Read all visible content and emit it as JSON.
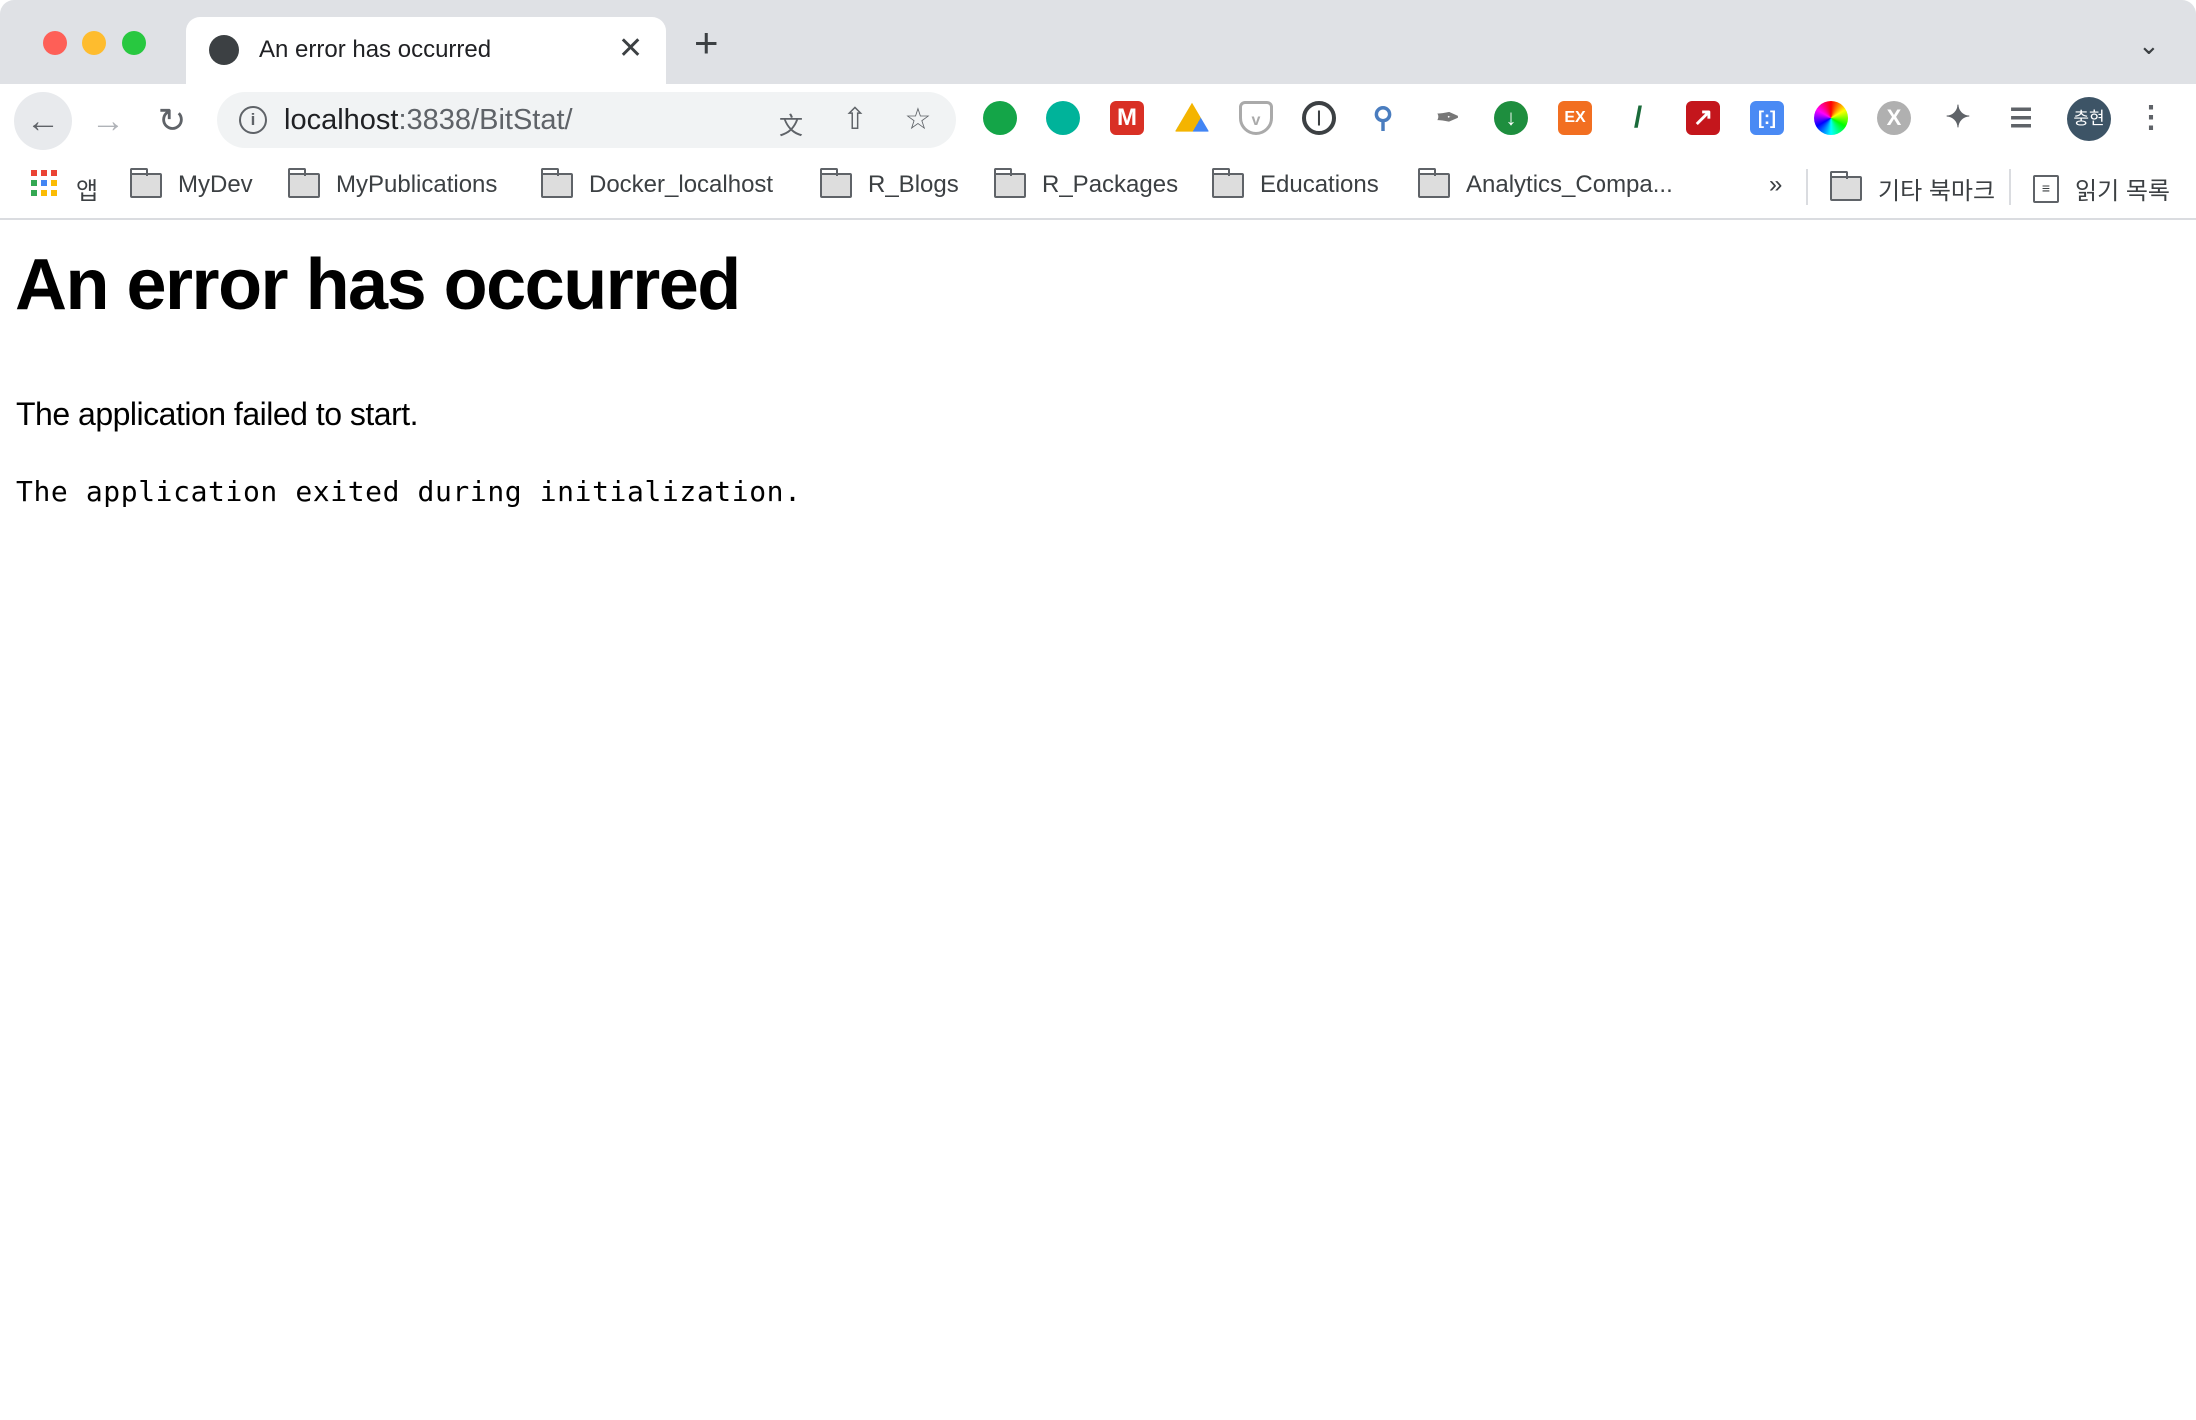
{
  "window": {
    "traffic_lights": {
      "close": "#fe5f57",
      "minimize": "#febc2e",
      "maximize": "#28c840"
    }
  },
  "tab": {
    "title": "An error has occurred",
    "icon": "globe-icon",
    "close_label": "✕",
    "new_tab_label": "+",
    "tab_menu_label": "⌄"
  },
  "toolbar": {
    "url_host": "localhost",
    "url_rest": ":3838/BitStat/",
    "extensions": [
      "evernote-icon",
      "mendeley-icon",
      "gmail-icon",
      "google-drive-icon",
      "pocket-icon",
      "1password-icon",
      "search-magnifier-icon",
      "eyedropper-icon",
      "download-icon",
      "ex-icon",
      "slash-icon",
      "pickaxe-icon",
      "tag-icon",
      "color-wheel-icon",
      "x-circle-icon",
      "extensions-puzzle-icon",
      "media-queue-icon"
    ],
    "ex_label": "EX",
    "avatar_label": "충현"
  },
  "bookmarks": {
    "apps_label": "앱",
    "items": [
      "MyDev",
      "MyPublications",
      "Docker_localhost",
      "R_Blogs",
      "R_Packages",
      "Educations",
      "Analytics_Compa..."
    ],
    "overflow_label": "»",
    "other_label": "기타 북마크",
    "reading_list_label": "읽기 목록"
  },
  "page": {
    "heading": "An error has occurred",
    "message": "The application failed to start.",
    "detail": "The application exited during initialization."
  }
}
